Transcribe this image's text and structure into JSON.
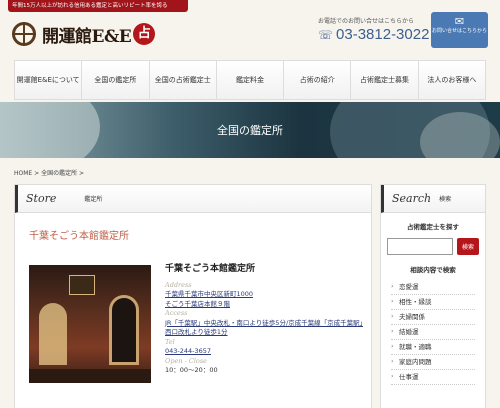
{
  "header": {
    "tagline": "年間15万人以上が訪れる信用ある鑑定と高いリピート率を誇る",
    "logo_text": "開運館E&E",
    "logo_seal": "占",
    "tel_note": "お電話でのお問い合せはこちらから",
    "tel": "03-3812-3022",
    "contact_button": "お問い合せはこちらから"
  },
  "nav": [
    "開運館E&Eについて",
    "全国の鑑定所",
    "全国の占術鑑定士",
    "鑑定料金",
    "占術の紹介",
    "占術鑑定士募集",
    "法人のお客様へ"
  ],
  "hero": {
    "title": "全国の鑑定所"
  },
  "breadcrumb": {
    "home": "HOME",
    "sep1": ">",
    "current": "全国の鑑定所",
    "sep2": ">"
  },
  "store_section": {
    "heading_en": "Store",
    "heading_ja": "鑑定所",
    "store_title": "千葉そごう本館鑑定所",
    "name": "千葉そごう本館鑑定所",
    "address_label": "Address",
    "address_line1": "千葉県千葉市中央区新町1000",
    "address_line2": "そごう千葉店本館９階",
    "access_label": "Access",
    "access_text": "JR「千葉駅」中央改札・南口より徒歩5分/京成千葉線「京成千葉駅」西口改札より徒歩1分",
    "tel_label": "Tel",
    "tel": "043-244-3657",
    "hours_label": "Open - Close",
    "hours": "10：00～20：00"
  },
  "sidebar": {
    "heading_en": "Search",
    "heading_ja": "検索",
    "find_label": "占術鑑定士を探す",
    "search_placeholder": "",
    "search_button": "検索",
    "category_title": "相談内容で検索",
    "categories": [
      "恋愛運",
      "相性・縁談",
      "夫婦関係",
      "結婚運",
      "就職・適職",
      "家庭内問題",
      "仕事運"
    ]
  }
}
